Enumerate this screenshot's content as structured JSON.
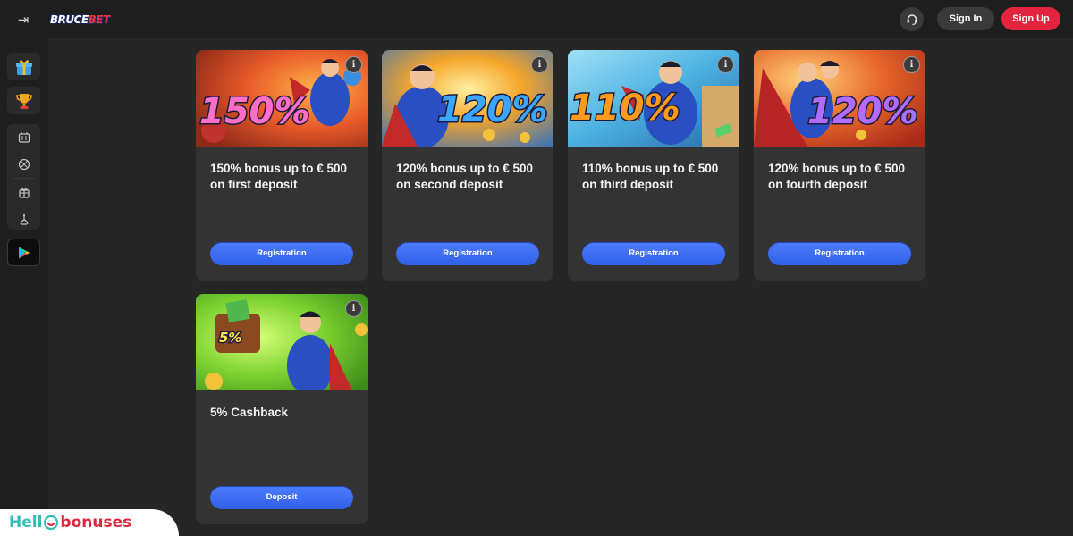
{
  "header": {
    "logo_main": "BRUCE",
    "logo_accent": "BET",
    "signin_label": "Sign In",
    "signup_label": "Sign Up"
  },
  "sidebar": {
    "items": [
      {
        "icon": "gift-box-icon"
      },
      {
        "icon": "trophy-icon"
      },
      {
        "icon": "slot-machine-icon"
      },
      {
        "icon": "basketball-icon"
      },
      {
        "icon": "gift-icon"
      },
      {
        "icon": "fishing-icon"
      },
      {
        "icon": "google-play-icon"
      }
    ]
  },
  "bonuses": [
    {
      "badge": "150%",
      "title": "150% bonus up to € 500 on first deposit",
      "button": "Registration",
      "bg": "#e0552b"
    },
    {
      "badge": "120%",
      "title": "120% bonus up to € 500 on second deposit",
      "button": "Registration",
      "bg": "#e88a2a"
    },
    {
      "badge": "110%",
      "title": "110% bonus up to € 500 on third deposit",
      "button": "Registration",
      "bg": "#3aa7d8"
    },
    {
      "badge": "120%",
      "title": "120% bonus up to € 500 on fourth deposit",
      "button": "Registration",
      "bg": "#e04a26"
    },
    {
      "badge": "5%",
      "title": "5% Cashback",
      "button": "Deposit",
      "bg": "#5fb324"
    }
  ],
  "watermark": {
    "hello": "Hell",
    "bonuses": "bonuses"
  },
  "colors": {
    "accent_red": "#e3243f",
    "button_blue": "#3f6ef5",
    "card_bg": "#333333",
    "page_bg": "#262626"
  }
}
